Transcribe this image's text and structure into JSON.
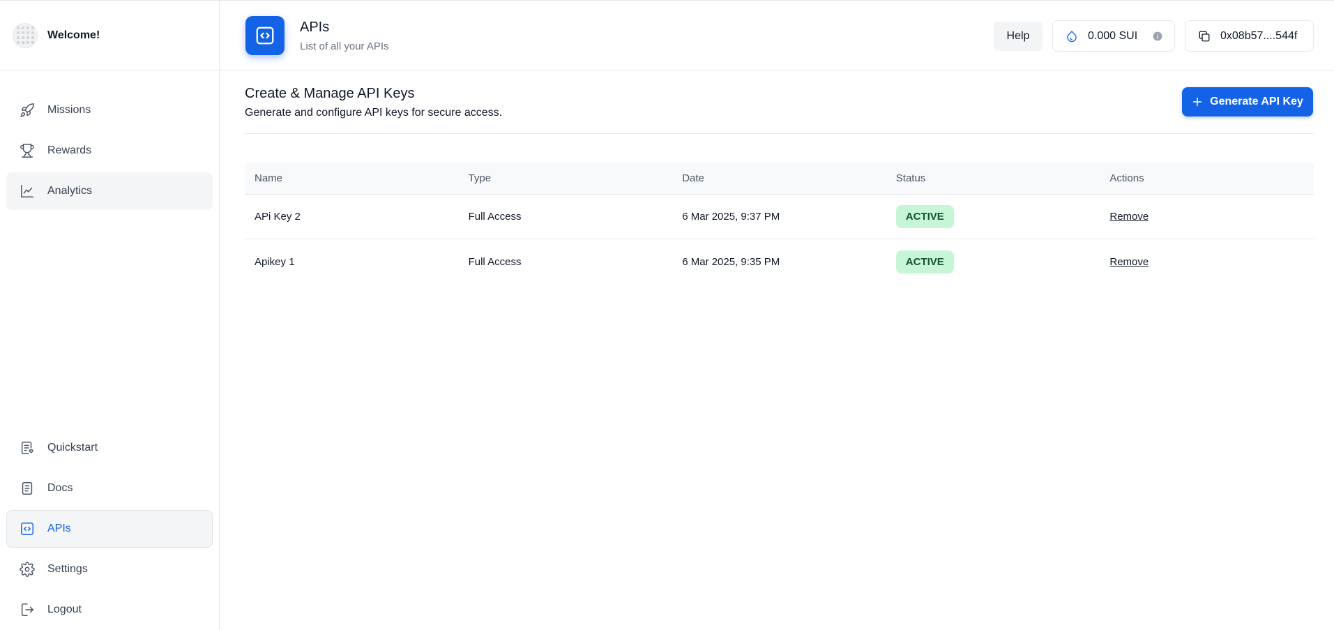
{
  "sidebar": {
    "welcome": "Welcome!",
    "top_items": [
      {
        "label": "Missions",
        "icon": "rocket-icon"
      },
      {
        "label": "Rewards",
        "icon": "trophy-icon"
      },
      {
        "label": "Analytics",
        "icon": "chart-line-icon"
      }
    ],
    "bottom_items": [
      {
        "label": "Quickstart",
        "icon": "quickstart-icon"
      },
      {
        "label": "Docs",
        "icon": "document-icon"
      },
      {
        "label": "APIs",
        "icon": "code-icon",
        "active": true
      },
      {
        "label": "Settings",
        "icon": "gear-icon"
      },
      {
        "label": "Logout",
        "icon": "logout-icon"
      }
    ]
  },
  "header": {
    "title": "APIs",
    "subtitle": "List of all your APIs",
    "help_label": "Help",
    "balance": "0.000 SUI",
    "wallet_address": "0x08b57....544f"
  },
  "main": {
    "section_title": "Create & Manage API Keys",
    "section_subtitle": "Generate and configure API keys for secure access.",
    "generate_label": "Generate API Key",
    "table": {
      "columns": [
        "Name",
        "Type",
        "Date",
        "Status",
        "Actions"
      ],
      "rows": [
        {
          "name": "APi Key 2",
          "type": "Full Access",
          "date": "6 Mar 2025, 9:37 PM",
          "status": "ACTIVE",
          "action": "Remove"
        },
        {
          "name": "Apikey 1",
          "type": "Full Access",
          "date": "6 Mar 2025, 9:35 PM",
          "status": "ACTIVE",
          "action": "Remove"
        }
      ]
    }
  },
  "colors": {
    "accent": "#1463e6",
    "active_badge_bg": "#c6f6d5",
    "active_badge_text": "#14532d"
  }
}
